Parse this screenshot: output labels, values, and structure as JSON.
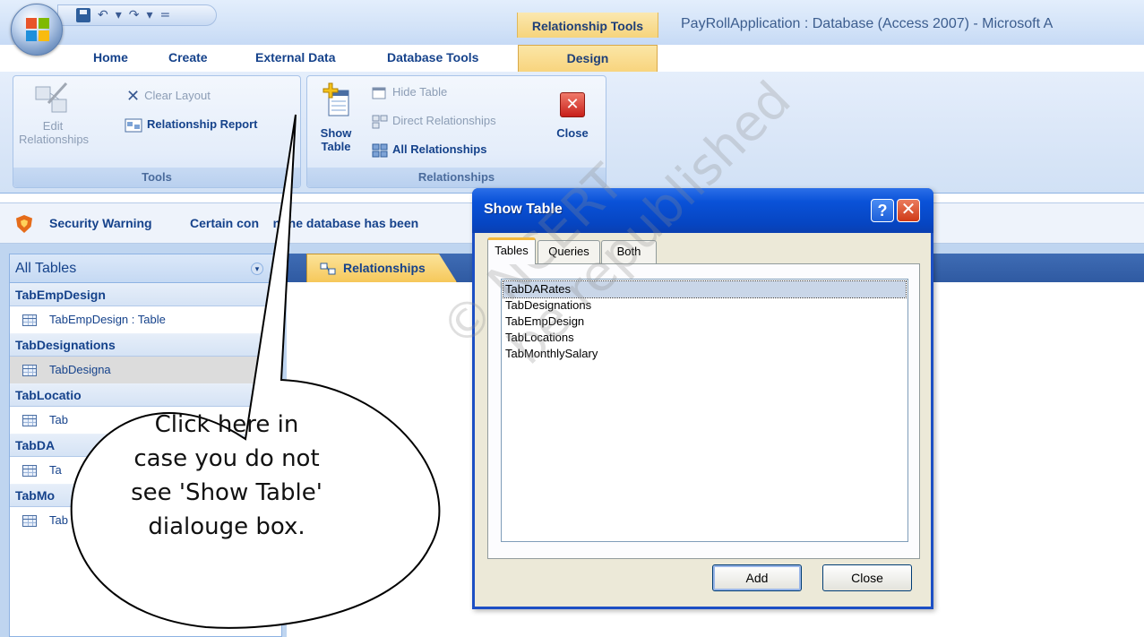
{
  "title_bar": {
    "contextual_tab_group": "Relationship Tools",
    "window_title": "PayRollApplication : Database (Access 2007) - Microsoft A"
  },
  "ribbon_tabs": [
    "Home",
    "Create",
    "External Data",
    "Database Tools",
    "Design"
  ],
  "ribbon": {
    "tools_group": {
      "label": "Tools",
      "edit_relationships_line1": "Edit",
      "edit_relationships_line2": "Relationships",
      "clear_layout": "Clear Layout",
      "relationship_report": "Relationship Report"
    },
    "relationships_group": {
      "label": "Relationships",
      "show_table_line1": "Show",
      "show_table_line2": "Table",
      "hide_table": "Hide Table",
      "direct_relationships": "Direct Relationships",
      "all_relationships": "All Relationships",
      "close": "Close"
    }
  },
  "security_bar": {
    "label": "Security Warning",
    "message": "Certain con    n the database has been"
  },
  "nav_pane": {
    "header": "All Tables",
    "groups": [
      {
        "name": "TabEmpDesign",
        "item": "TabEmpDesign : Table"
      },
      {
        "name": "TabDesignations",
        "item": "TabDesigna"
      },
      {
        "name": "TabLocatio",
        "item": "Tab"
      },
      {
        "name": "TabDA",
        "item": "Ta"
      },
      {
        "name": "TabMo",
        "item": "Tab"
      }
    ]
  },
  "document_tab": "Relationships",
  "show_table_dialog": {
    "title": "Show Table",
    "help_glyph": "?",
    "close_glyph": "✕",
    "tabs": [
      "Tables",
      "Queries",
      "Both"
    ],
    "active_tab": "Tables",
    "items": [
      "TabDARates",
      "TabDesignations",
      "TabEmpDesign",
      "TabLocations",
      "TabMonthlySalary"
    ],
    "selected_item": "TabDARates",
    "add_button": "Add",
    "close_button": "Close"
  },
  "callout": {
    "line1": "Click here in",
    "line2": "case you do not",
    "line3": "see 'Show Table'",
    "line4": "dialouge box."
  },
  "watermark": {
    "line1": "© NCERT",
    "line2": "be republished"
  },
  "colors": {
    "accent_blue": "#15428b",
    "contextual_tab": "#f8d37b",
    "dialog_title": "#0a52d8",
    "warning_shield": "#e56c1a"
  }
}
